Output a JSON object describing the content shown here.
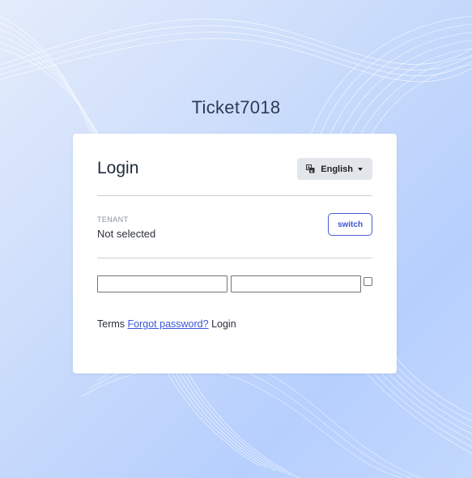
{
  "app": {
    "title": "Ticket7018"
  },
  "login_card": {
    "title": "Login",
    "language": {
      "selected": "English",
      "icon": "translate-icon"
    },
    "tenant": {
      "label": "TENANT",
      "value": "Not selected",
      "switch_label": "switch"
    },
    "fields": {
      "username_value": "",
      "password_value": "",
      "remember_checked": false
    },
    "footer": {
      "terms_label": "Terms",
      "forgot_password_label": "Forgot password?",
      "login_label": "Login"
    }
  },
  "colors": {
    "accent": "#3e55cc",
    "background": "#cbdcfb",
    "card": "#ffffff"
  }
}
